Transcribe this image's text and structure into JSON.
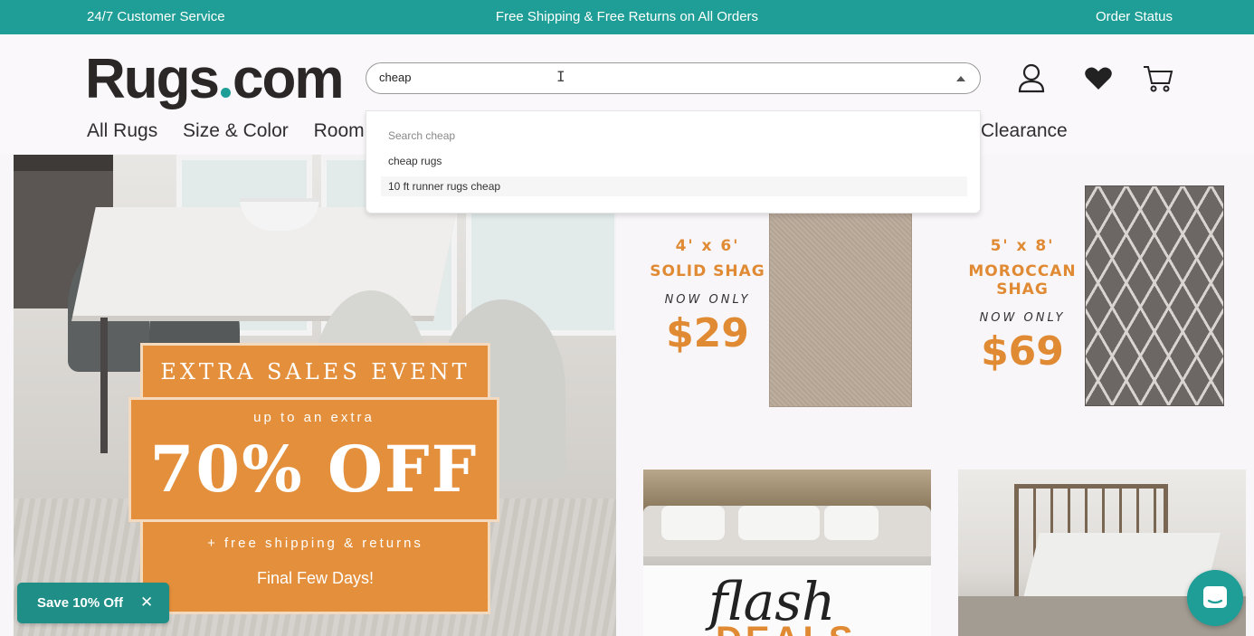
{
  "topbar": {
    "left": "24/7 Customer Service",
    "center": "Free Shipping & Free Returns on All Orders",
    "right": "Order Status"
  },
  "logo": {
    "part1": "Rugs",
    "part2": "com"
  },
  "search": {
    "value": "cheap"
  },
  "suggestions": {
    "hint": "Search cheap",
    "items": [
      "cheap rugs",
      "10 ft runner rugs cheap"
    ]
  },
  "nav": {
    "items": [
      "All Rugs",
      "Size & Color",
      "Room"
    ],
    "clearance": "Clearance"
  },
  "hero": {
    "title": "EXTRA SALES EVENT",
    "up_to": "up to an extra",
    "discount": "70% OFF",
    "shipping": "+ free shipping & returns",
    "final": "Final Few Days!"
  },
  "deals": [
    {
      "size": "4' x 6'",
      "name": "SOLID SHAG",
      "now": "NOW ONLY",
      "price": "$29"
    },
    {
      "size": "5' x 8'",
      "name": "MOROCCAN SHAG",
      "now": "NOW ONLY",
      "price": "$69"
    }
  ],
  "flash": {
    "word1": "flash",
    "word2": "DEALS"
  },
  "save_popup": {
    "label": "Save 10% Off",
    "close": "✕"
  },
  "colors": {
    "brand_teal": "#1e9e96",
    "accent_orange": "#e48f3b"
  }
}
